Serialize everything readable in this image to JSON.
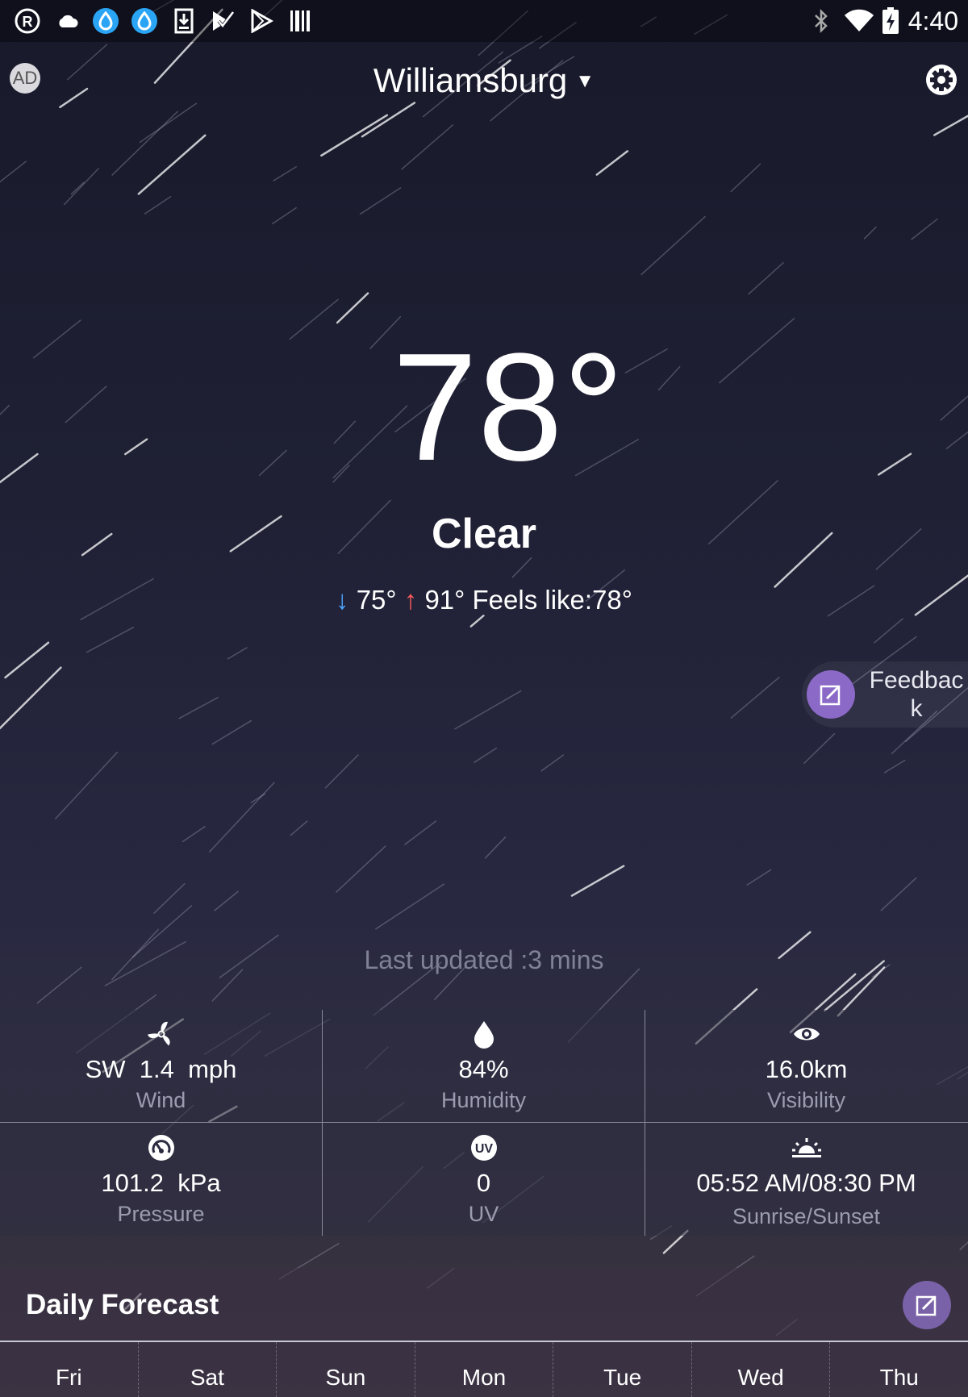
{
  "status_bar": {
    "time": "4:40",
    "left_icons": [
      "registered-icon",
      "cloud-icon",
      "water-drop-app-icon",
      "water-drop-app-icon",
      "download-icon",
      "task-check-icon",
      "play-store-icon",
      "barcode-icon"
    ],
    "right_icons": [
      "bluetooth-icon",
      "wifi-icon",
      "battery-charging-icon"
    ]
  },
  "header": {
    "ad_label": "AD",
    "city": "Williamsburg",
    "city_caret": "▼"
  },
  "current": {
    "temperature": "78°",
    "condition": "Clear",
    "low_arrow": "↓",
    "low": "75°",
    "high_arrow": "↑",
    "high": "91°",
    "feels_like": "Feels like:78°",
    "last_updated": "Last updated :3 mins"
  },
  "feedback": {
    "label": "Feedback"
  },
  "details": [
    {
      "icon": "fan-icon",
      "value": "SW  1.4  mph",
      "label": "Wind"
    },
    {
      "icon": "drop-icon",
      "value": "84%",
      "label": "Humidity"
    },
    {
      "icon": "eye-icon",
      "value": "16.0km",
      "label": "Visibility"
    },
    {
      "icon": "gauge-icon",
      "value": "101.2  kPa",
      "label": "Pressure"
    },
    {
      "icon": "uv-icon",
      "value": "0",
      "label": "UV",
      "icon_text": "UV"
    },
    {
      "icon": "sunrise-icon",
      "value": "05:52 AM/08:30 PM",
      "label": "Sunrise/Sunset"
    }
  ],
  "daily": {
    "title": "Daily Forecast",
    "days": [
      "Fri",
      "Sat",
      "Sun",
      "Mon",
      "Tue",
      "Wed",
      "Thu"
    ]
  },
  "colors": {
    "low_arrow": "#4da6ff",
    "high_arrow": "#ff5d5d",
    "accent_purple": "#8b69c7"
  }
}
